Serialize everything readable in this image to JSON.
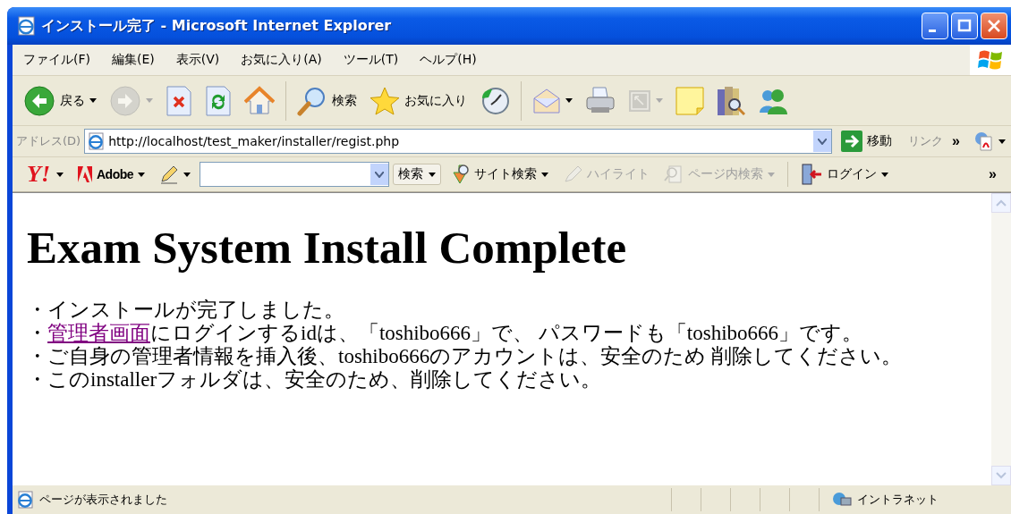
{
  "window": {
    "title": "インストール完了 - Microsoft Internet Explorer"
  },
  "menu": [
    {
      "label": "ファイル(F)"
    },
    {
      "label": "編集(E)"
    },
    {
      "label": "表示(V)"
    },
    {
      "label": "お気に入り(A)"
    },
    {
      "label": "ツール(T)"
    },
    {
      "label": "ヘルプ(H)"
    }
  ],
  "toolbar": [
    {
      "kind": "back",
      "label": "戻る",
      "disabled": false,
      "menu": true
    },
    {
      "kind": "forward",
      "disabled": true,
      "menu": true
    },
    {
      "kind": "stop",
      "disabled": false
    },
    {
      "kind": "refresh",
      "disabled": false
    },
    {
      "kind": "home",
      "disabled": false
    },
    {
      "kind": "separator"
    },
    {
      "kind": "search",
      "label": "検索",
      "disabled": false
    },
    {
      "kind": "favorites",
      "label": "お気に入り",
      "disabled": false
    },
    {
      "kind": "history",
      "disabled": false
    },
    {
      "kind": "separator"
    },
    {
      "kind": "mail",
      "disabled": false,
      "menu": true
    },
    {
      "kind": "print",
      "disabled": false
    },
    {
      "kind": "fullscreen",
      "disabled": true,
      "menu": true
    },
    {
      "kind": "note",
      "disabled": false
    },
    {
      "kind": "research",
      "disabled": false
    },
    {
      "kind": "messenger",
      "disabled": false
    }
  ],
  "address": {
    "label": "アドレス(D)",
    "url": "http://localhost/test_maker/installer/regist.php",
    "go": "移動",
    "links": "リンク",
    "more": "»"
  },
  "yahoo_toolbar": {
    "logo": "Y!",
    "items": [
      {
        "kind": "adobe",
        "label": "Adobe",
        "disabled": false,
        "menu": true
      },
      {
        "kind": "pencil",
        "disabled": false,
        "menu": true
      },
      {
        "kind": "combo"
      },
      {
        "kind": "button",
        "label": "検索",
        "disabled": false,
        "menu": true
      },
      {
        "kind": "site-search",
        "label": "サイト検索",
        "disabled": false,
        "menu": true
      },
      {
        "kind": "highlight",
        "label": "ハイライト",
        "disabled": true
      },
      {
        "kind": "page-search",
        "label": "ページ内検索",
        "disabled": true,
        "menu": true
      },
      {
        "kind": "separator"
      },
      {
        "kind": "login",
        "label": "ログイン",
        "disabled": false,
        "menu": true
      }
    ],
    "more": "»"
  },
  "page": {
    "heading": "Exam System Install Complete",
    "lines": [
      {
        "text": "・インストールが完了しました。"
      },
      {
        "prefix": "・",
        "link": "管理者画面",
        "text": "にログインするidは、「toshibo666」で、 パスワードも「toshibo666」です。"
      },
      {
        "text": "・ご自身の管理者情報を挿入後、toshibo666のアカウントは、安全のため 削除してください。"
      },
      {
        "text": "・このinstallerフォルダは、安全のため、削除してください。"
      }
    ]
  },
  "status_bar": {
    "text": "ページが表示されました",
    "zone": "イントラネット"
  }
}
